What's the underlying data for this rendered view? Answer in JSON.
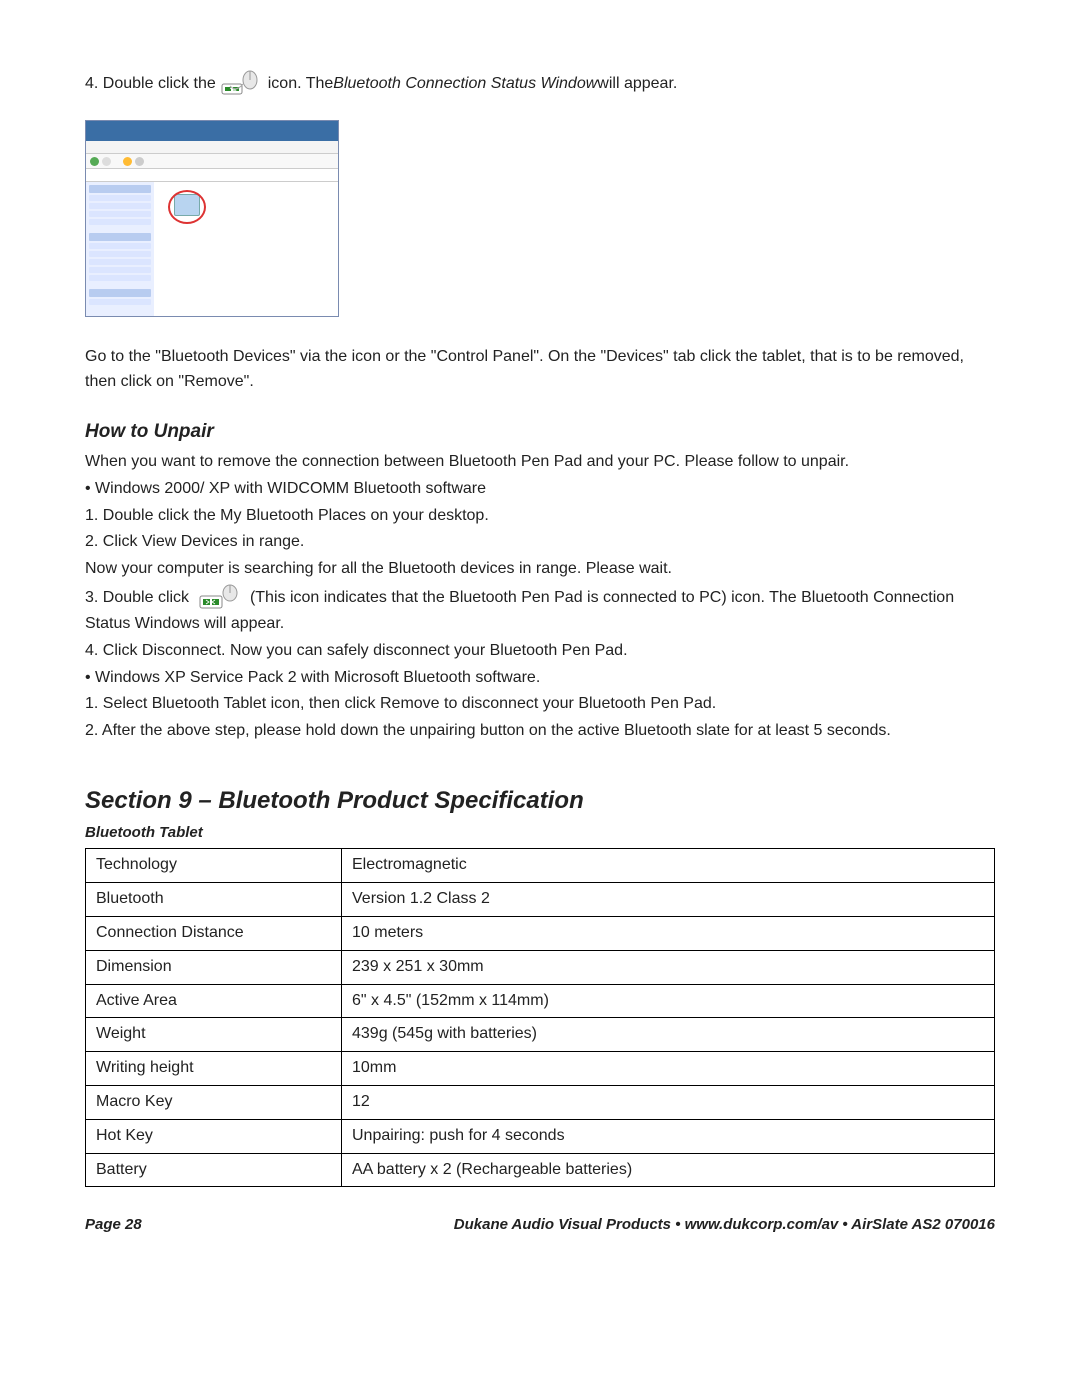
{
  "step4": {
    "prefix": "4.  Double click the ",
    "mid": " icon.  The ",
    "italic": "Bluetooth Connection Status Window",
    "suffix": " will appear."
  },
  "para1": "Go to the \"Bluetooth Devices\" via the icon or the \"Control Panel\".  On the \"Devices\" tab click the tablet, that is to be removed, then click on \"Remove\".",
  "unpair": {
    "heading": "How to Unpair",
    "intro": "When you want to remove the connection between Bluetooth Pen Pad and your PC. Please follow  to unpair.",
    "b1": "•  Windows 2000/ XP with WIDCOMM Bluetooth software",
    "s1": "1. Double click the My Bluetooth Places on your desktop.",
    "s2": "2. Click View Devices in range.",
    "wait": "Now your computer is searching for all the Bluetooth devices in range. Please wait.",
    "s3a": "3. Double click  ",
    "s3b": " (This icon indicates that the Bluetooth Pen Pad is connected to PC) icon.  The Bluetooth Connection Status Windows will appear.",
    "s4": "4. Click Disconnect. Now you can safely disconnect your Bluetooth Pen Pad.",
    "b2": "•  Windows XP Service Pack 2 with Microsoft Bluetooth software.",
    "x1": "1.  Select Bluetooth Tablet icon, then click Remove to disconnect your Bluetooth Pen Pad.",
    "x2": "2.  After the above step, please hold down the unpairing button on the active Bluetooth slate for at least 5 seconds."
  },
  "section9": {
    "heading": "Section 9 – Bluetooth Product Specification",
    "sub": "Bluetooth Tablet",
    "rows": [
      {
        "k": "Technology",
        "v": "Electromagnetic"
      },
      {
        "k": "Bluetooth",
        "v": "Version 1.2 Class 2"
      },
      {
        "k": "Connection Distance",
        "v": "10 meters"
      },
      {
        "k": "Dimension",
        "v": "239 x 251 x 30mm"
      },
      {
        "k": "Active Area",
        "v": "6\" x 4.5\" (152mm x 114mm)"
      },
      {
        "k": "Weight",
        "v": "439g (545g with batteries)"
      },
      {
        "k": "Writing height",
        "v": "10mm"
      },
      {
        "k": "Macro Key",
        "v": "12"
      },
      {
        "k": "Hot Key",
        "v": "Unpairing: push for 4 seconds"
      },
      {
        "k": "Battery",
        "v": "AA battery x 2 (Rechargeable batteries)"
      }
    ]
  },
  "footer": {
    "page": "Page 28",
    "right": "Dukane Audio Visual Products • www.dukcorp.com/av • AirSlate AS2 070016"
  }
}
